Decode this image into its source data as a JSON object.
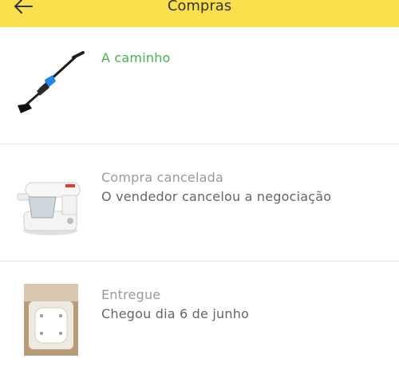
{
  "header": {
    "title": "Compras",
    "back_icon": "arrow-left-icon",
    "background": "#fbe04d"
  },
  "purchases": [
    {
      "status": "A caminho",
      "status_color": "#4caf50",
      "description": "",
      "image": "vacuum-cleaner"
    },
    {
      "status": "Compra cancelada",
      "status_color": "#999999",
      "description": "O vendedor cancelou a negociação",
      "image": "stand-mixer"
    },
    {
      "status": "Entregue",
      "status_color": "#999999",
      "description": "Chegou dia 6 de junho",
      "image": "bathtub"
    }
  ]
}
